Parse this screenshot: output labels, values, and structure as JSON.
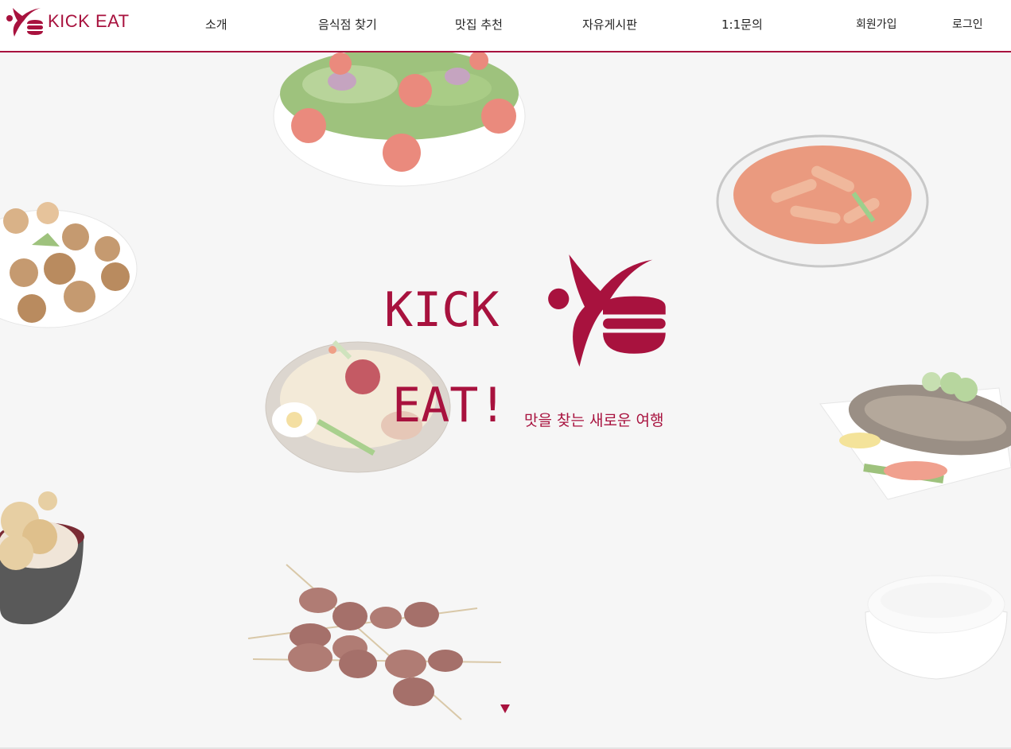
{
  "brand": {
    "name": "KICK EAT",
    "color": "#a8123e",
    "icon": "kick-eat-logo-icon"
  },
  "nav": {
    "items": [
      {
        "label": "소개"
      },
      {
        "label": "음식점 찾기"
      },
      {
        "label": "맛집 추천"
      },
      {
        "label": "자유게시판"
      },
      {
        "label": "1:1문의"
      }
    ],
    "signup_label": "회원가입",
    "login_label": "로그인"
  },
  "hero": {
    "title_line1": "KICK",
    "title_line2": "EAT!",
    "tagline": "맛을 찾는 새로운 여행"
  },
  "decor": {
    "images": [
      "salad",
      "tteokbokki",
      "croquettes",
      "cold-noodles",
      "grilled-fish",
      "tempura-rice-bowl",
      "meat-skewers",
      "rice-bowl"
    ]
  },
  "scroll": {
    "icon": "down-triangle-icon"
  }
}
